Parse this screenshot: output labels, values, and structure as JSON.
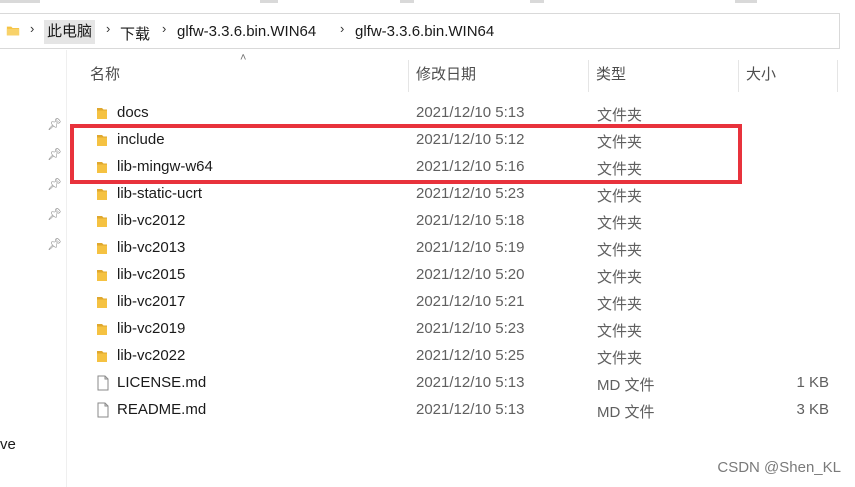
{
  "address_bar": {
    "breadcrumbs": [
      "此电脑",
      "下载",
      "glfw-3.3.6.bin.WIN64",
      "glfw-3.3.6.bin.WIN64"
    ]
  },
  "nav": {
    "partial_label": "ve"
  },
  "columns": {
    "name": "名称",
    "date": "修改日期",
    "type": "类型",
    "size": "大小"
  },
  "files": [
    {
      "name": "docs",
      "date": "2021/12/10 5:13",
      "type": "文件夹",
      "size": "",
      "kind": "folder"
    },
    {
      "name": "include",
      "date": "2021/12/10 5:12",
      "type": "文件夹",
      "size": "",
      "kind": "folder"
    },
    {
      "name": "lib-mingw-w64",
      "date": "2021/12/10 5:16",
      "type": "文件夹",
      "size": "",
      "kind": "folder"
    },
    {
      "name": "lib-static-ucrt",
      "date": "2021/12/10 5:23",
      "type": "文件夹",
      "size": "",
      "kind": "folder"
    },
    {
      "name": "lib-vc2012",
      "date": "2021/12/10 5:18",
      "type": "文件夹",
      "size": "",
      "kind": "folder"
    },
    {
      "name": "lib-vc2013",
      "date": "2021/12/10 5:19",
      "type": "文件夹",
      "size": "",
      "kind": "folder"
    },
    {
      "name": "lib-vc2015",
      "date": "2021/12/10 5:20",
      "type": "文件夹",
      "size": "",
      "kind": "folder"
    },
    {
      "name": "lib-vc2017",
      "date": "2021/12/10 5:21",
      "type": "文件夹",
      "size": "",
      "kind": "folder"
    },
    {
      "name": "lib-vc2019",
      "date": "2021/12/10 5:23",
      "type": "文件夹",
      "size": "",
      "kind": "folder"
    },
    {
      "name": "lib-vc2022",
      "date": "2021/12/10 5:25",
      "type": "文件夹",
      "size": "",
      "kind": "folder"
    },
    {
      "name": "LICENSE.md",
      "date": "2021/12/10 5:13",
      "type": "MD 文件",
      "size": "1 KB",
      "kind": "file"
    },
    {
      "name": "README.md",
      "date": "2021/12/10 5:13",
      "type": "MD 文件",
      "size": "3 KB",
      "kind": "file"
    }
  ],
  "watermark": "CSDN @Shen_KL",
  "colors": {
    "folder": "#f5c242",
    "highlight": "#e8323c",
    "selected_crumb": "#e5e5e5"
  }
}
